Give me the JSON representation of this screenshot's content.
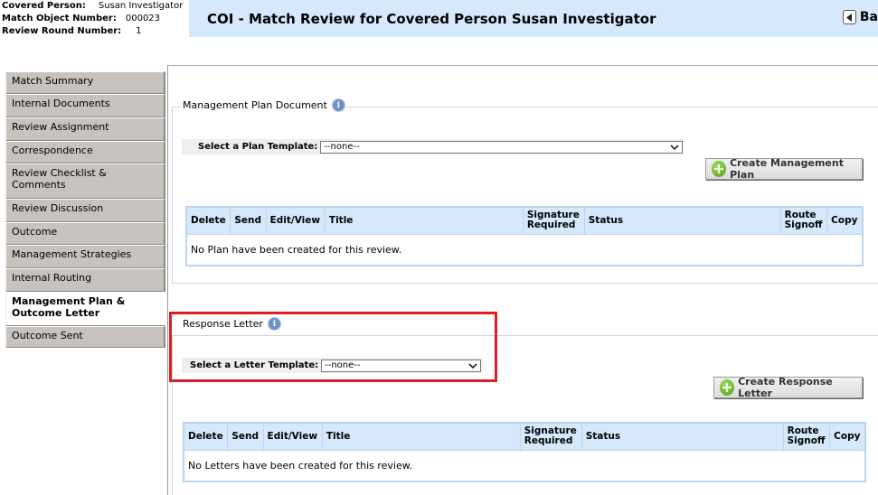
{
  "info": {
    "covered_person_label": "Covered Person:",
    "covered_person_value": "Susan Investigator",
    "match_object_label": "Match Object Number:",
    "match_object_value": "000023",
    "review_round_label": "Review Round Number:",
    "review_round_value": "1"
  },
  "header": {
    "title": "COI - Match Review for Covered Person Susan Investigator",
    "back_label": "Ba"
  },
  "sidebar": {
    "items": [
      {
        "label": "Match Summary"
      },
      {
        "label": "Internal Documents"
      },
      {
        "label": "Review Assignment"
      },
      {
        "label": "Correspondence"
      },
      {
        "label": "Review Checklist & Comments"
      },
      {
        "label": "Review Discussion"
      },
      {
        "label": "Outcome"
      },
      {
        "label": "Management Strategies"
      },
      {
        "label": "Internal Routing"
      },
      {
        "label": "Management Plan & Outcome Letter"
      },
      {
        "label": "Outcome Sent"
      }
    ],
    "active_index": 9
  },
  "plan": {
    "title": "Management Plan Document",
    "template_label": "Select a Plan Template:",
    "template_value": "--none--",
    "create_button": "Create Management Plan",
    "columns": [
      "Delete",
      "Send",
      "Edit/View",
      "Title",
      "Signature Required",
      "Status",
      "Route Signoff",
      "Copy"
    ],
    "empty_message": "No Plan have been created for this review."
  },
  "letter": {
    "title": "Response Letter",
    "template_label": "Select a Letter Template:",
    "template_value": "--none--",
    "create_button": "Create Response Letter",
    "columns": [
      "Delete",
      "Send",
      "Edit/View",
      "Title",
      "Signature Required",
      "Status",
      "Route Signoff",
      "Copy"
    ],
    "empty_message": "No Letters have been created for this review."
  },
  "colors": {
    "header_bg": "#d6e8fb",
    "nav_bg": "#c7c2bd",
    "highlight": "#e01c24",
    "grid_border": "#bcd4ee"
  }
}
